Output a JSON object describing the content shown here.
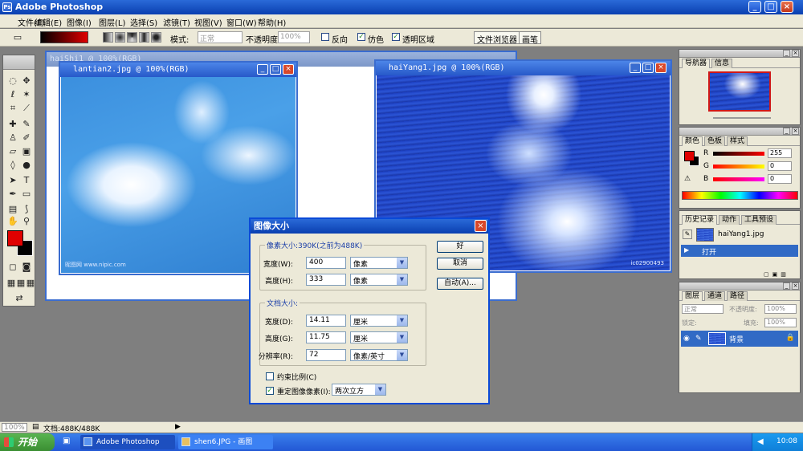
{
  "app": {
    "title": "Adobe Photoshop"
  },
  "menu": [
    "文件(F)",
    "编辑(E)",
    "图像(I)",
    "图层(L)",
    "选择(S)",
    "滤镜(T)",
    "视图(V)",
    "窗口(W)",
    "帮助(H)"
  ],
  "options": {
    "mode_label": "模式:",
    "mode_value": "正常",
    "opacity_label": "不透明度:",
    "opacity_value": "100%",
    "reverse_label": "反向",
    "dither_label": "仿色",
    "transparency_label": "透明区域",
    "well_file_browser": "文件浏览器",
    "well_brushes": "画笔"
  },
  "documents": {
    "back": {
      "title": "haiShi1 @ 100%(RGB)"
    },
    "sky": {
      "title": "lantian2.jpg @ 100%(RGB)",
      "watermark": "昵图网 www.nipic.com"
    },
    "sea": {
      "title": "haiYang1.jpg @ 100%(RGB)",
      "watermark": "ic02900493"
    }
  },
  "panels": {
    "navigator": {
      "tabs": [
        "导航器",
        "信息"
      ]
    },
    "color": {
      "tabs": [
        "颜色",
        "色板",
        "样式"
      ],
      "r_label": "R",
      "g_label": "G",
      "b_label": "B",
      "r_value": "255",
      "g_value": "0",
      "b_value": "0"
    },
    "history": {
      "tabs": [
        "历史记录",
        "动作",
        "工具预设"
      ],
      "snapshot": "haiYang1.jpg",
      "step": "打开"
    },
    "layers": {
      "tabs": [
        "图层",
        "通道",
        "路径"
      ],
      "blend": "正常",
      "opacity_label": "不透明度:",
      "opacity_value": "100%",
      "lock_label": "锁定:",
      "fill_label": "填充:",
      "fill_value": "100%",
      "layer_name": "背景"
    }
  },
  "dialog": {
    "title": "图像大小",
    "pixel_group": "像素大小:390K(之前为488K)",
    "px_width_label": "宽度(W):",
    "px_width": "400",
    "px_width_unit": "像素",
    "px_height_label": "高度(H):",
    "px_height": "333",
    "px_height_unit": "像素",
    "doc_group": "文档大小:",
    "doc_width_label": "宽度(D):",
    "doc_width": "14.11",
    "doc_width_unit": "厘米",
    "doc_height_label": "高度(G):",
    "doc_height": "11.75",
    "doc_height_unit": "厘米",
    "res_label": "分辨率(R):",
    "res": "72",
    "res_unit": "像素/英寸",
    "constrain_label": "约束比例(C)",
    "constrain_checked": false,
    "resample_label": "重定图像像素(I):",
    "resample_checked": true,
    "resample_method": "两次立方",
    "ok": "好",
    "cancel": "取消",
    "auto": "自动(A)..."
  },
  "status": {
    "zoom": "100%",
    "doc": "文档:488K/488K"
  },
  "taskbar": {
    "start": "开始",
    "items": [
      "Adobe Photoshop",
      "shen6.JPG - 画图"
    ],
    "clock": "10:08"
  },
  "colors": {
    "fg": "#e00000",
    "bg": "#000000",
    "accent": "#0a4ad8"
  }
}
